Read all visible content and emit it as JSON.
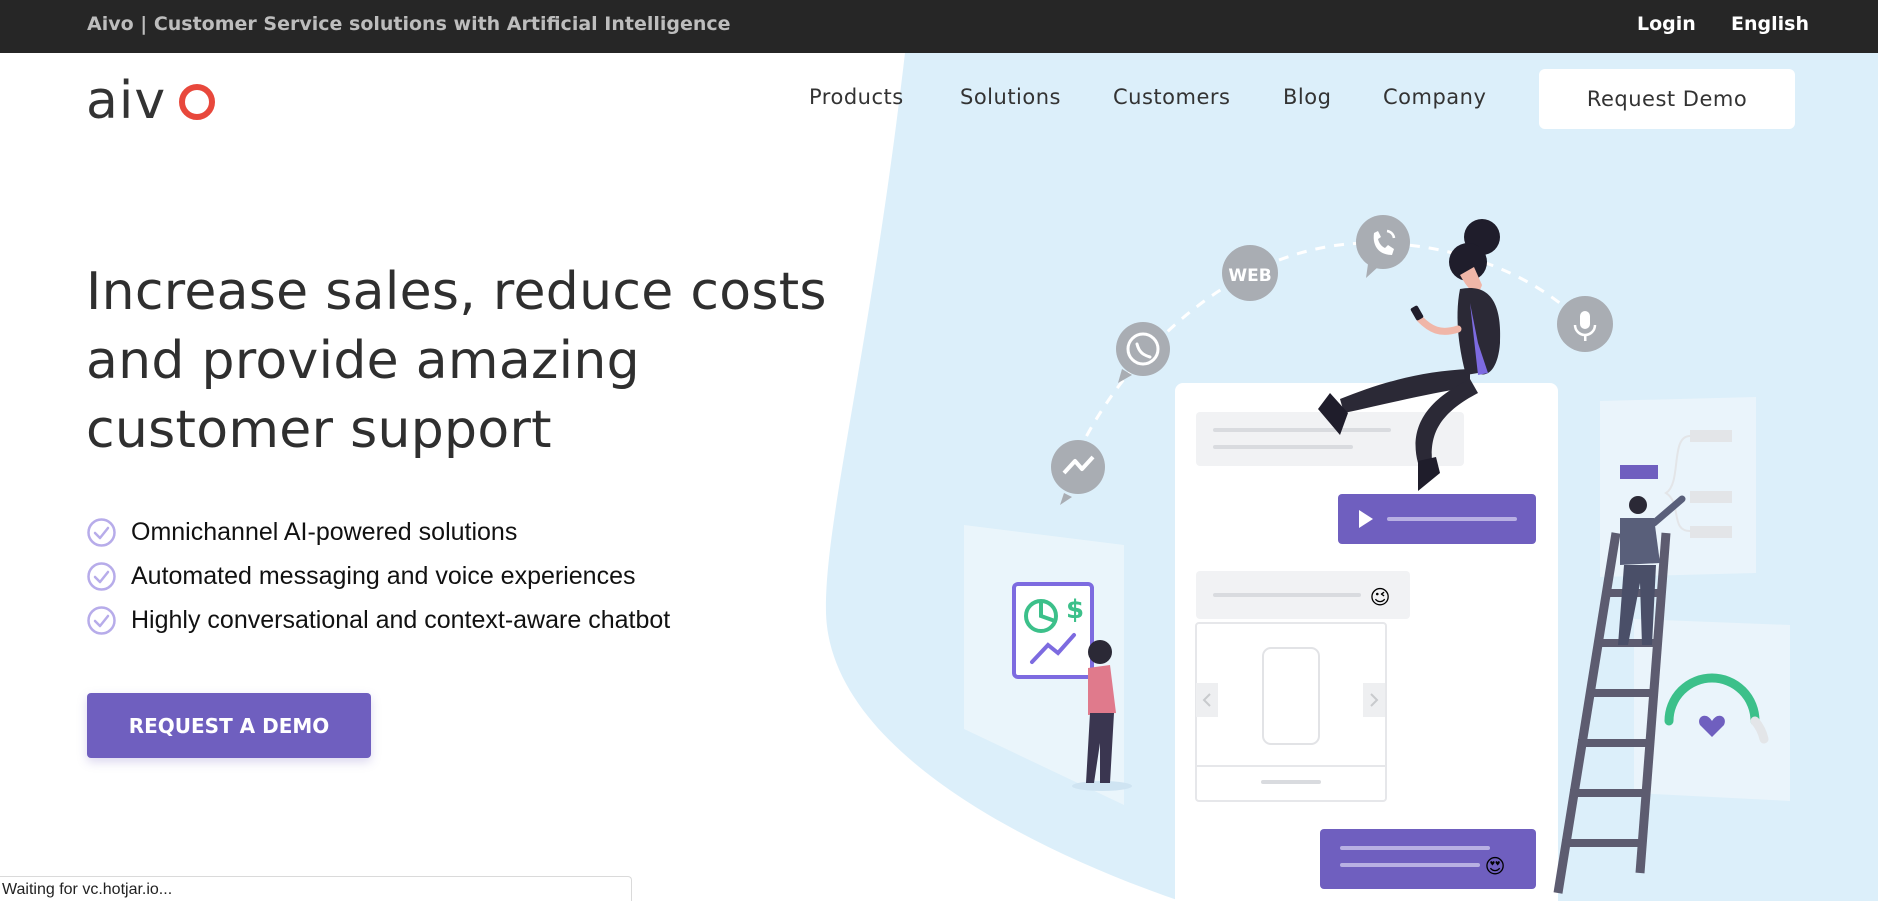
{
  "topbar": {
    "title": "Aivo | Customer Service solutions with Artificial Intelligence",
    "login_label": "Login",
    "language_label": "English"
  },
  "header": {
    "logo_text": "aivo",
    "nav": [
      {
        "label": "Products"
      },
      {
        "label": "Solutions"
      },
      {
        "label": "Customers"
      },
      {
        "label": "Blog"
      },
      {
        "label": "Company"
      }
    ],
    "request_demo_label": "Request Demo"
  },
  "hero": {
    "title_lines": [
      "Increase sales, reduce costs",
      "and provide amazing",
      "customer support"
    ],
    "bullets": [
      {
        "text": "Omnichannel AI-powered solutions"
      },
      {
        "text": "Automated messaging and voice experiences"
      },
      {
        "text": "Highly conversational and context-aware chatbot"
      }
    ],
    "cta_label": "REQUEST A DEMO"
  },
  "illustration": {
    "web_badge": "WEB",
    "dollar_sign": "$",
    "emoji_wink": "😉",
    "emoji_heart_eyes": "😍"
  },
  "statusbar": {
    "text": "Waiting for vc.hotjar.io..."
  },
  "colors": {
    "topbar_bg": "#262626",
    "accent_purple": "#6f5fbf",
    "hero_blue": "#dceffa",
    "logo_red": "#e8483c",
    "icon_gray": "#a9adb3",
    "green": "#3cc08a"
  }
}
